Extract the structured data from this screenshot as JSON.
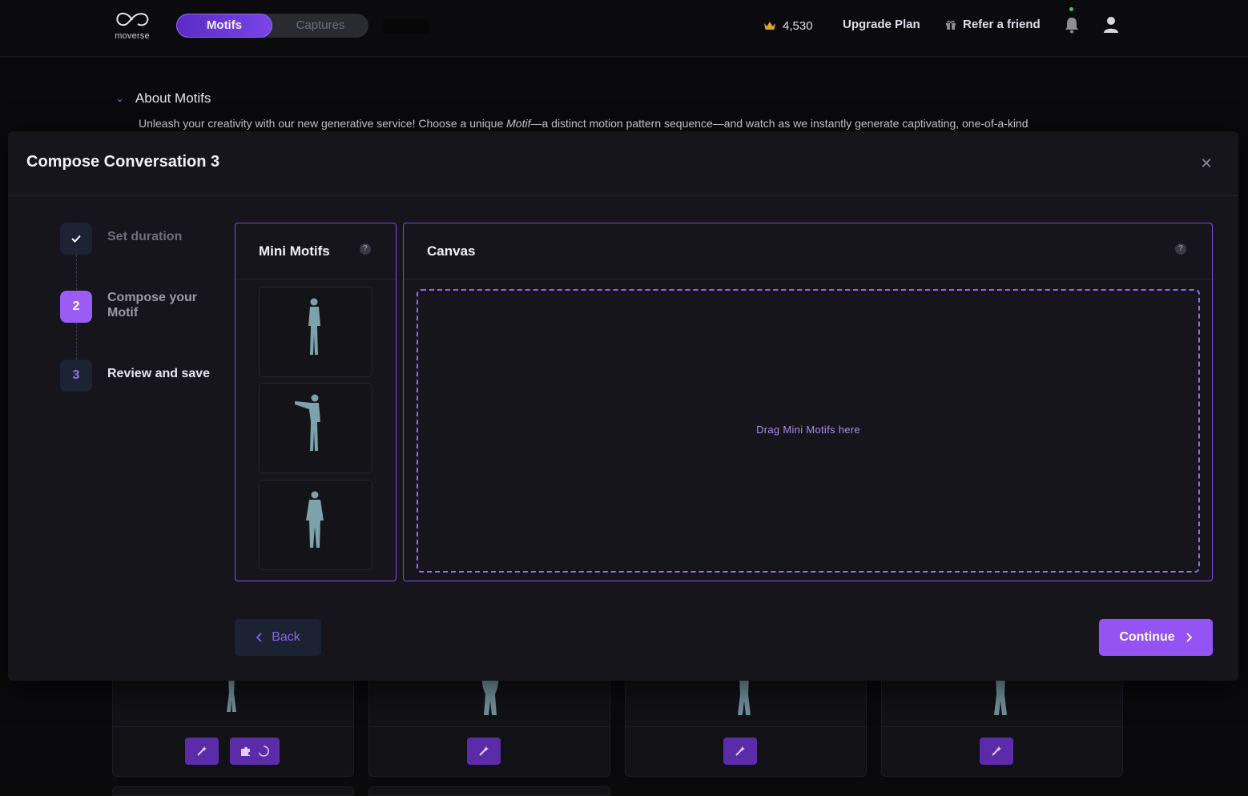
{
  "nav": {
    "logo_text": "moverse",
    "tabs": [
      {
        "label": "Motifs",
        "active": true
      },
      {
        "label": "Captures",
        "active": false
      }
    ],
    "credits": "4,530",
    "upgrade_label": "Upgrade Plan",
    "refer_label": "Refer a friend",
    "icons": [
      "crown-icon",
      "gift-icon",
      "bell-icon",
      "user-icon"
    ]
  },
  "about": {
    "title": "About Motifs",
    "text_before": "Unleash your creativity with our new generative service! Choose a unique ",
    "text_em": "Motif",
    "text_after": "—a distinct motion pattern sequence—and watch as we instantly generate captivating, one-of-a-kind"
  },
  "modal": {
    "title": "Compose Conversation 3",
    "close_icon": "close-icon",
    "steps": [
      {
        "number": "1",
        "label": "Set duration",
        "state": "done"
      },
      {
        "number": "2",
        "label": "Compose your Motif",
        "state": "active"
      },
      {
        "number": "3",
        "label": "Review and save",
        "state": "todo"
      }
    ],
    "mini_motifs": {
      "title": "Mini Motifs",
      "help": "?",
      "items": [
        {
          "name": "mini-motif-1",
          "pose": "standing"
        },
        {
          "name": "mini-motif-2",
          "pose": "pointing"
        },
        {
          "name": "mini-motif-3",
          "pose": "standing"
        }
      ]
    },
    "canvas": {
      "title": "Canvas",
      "help": "?",
      "placeholder": "Drag Mini Motifs here"
    },
    "back_label": "Back",
    "continue_label": "Continue"
  },
  "colors": {
    "accent": "#9553f4",
    "accent_border": "#7c4ee4",
    "background": "#0a0a0c",
    "modal_bg": "#15151b"
  }
}
